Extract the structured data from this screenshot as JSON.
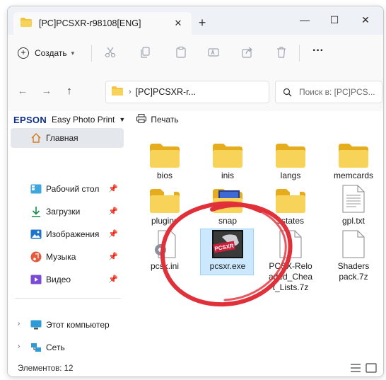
{
  "window": {
    "tab_title": "[PC]PCSXR-r98108[ENG]",
    "tab_close": "✕",
    "new_tab": "+",
    "minimize": "—",
    "maximize": "☐",
    "close": "✕"
  },
  "toolbar": {
    "create_label": "Создать",
    "more": "···"
  },
  "address": {
    "path": "[PC]PCSXR-r...",
    "search_placeholder": "Поиск в: [PC]PCS..."
  },
  "epson": {
    "logo": "EPSON",
    "app": "Easy Photo Print",
    "print": "Печать"
  },
  "sidebar": {
    "items": [
      {
        "label": "Главная"
      },
      {
        "label": "Рабочий стол"
      },
      {
        "label": "Загрузки"
      },
      {
        "label": "Изображения"
      },
      {
        "label": "Музыка"
      },
      {
        "label": "Видео"
      },
      {
        "label": "Этот компьютер"
      },
      {
        "label": "Сеть"
      }
    ]
  },
  "files": [
    {
      "name": "bios",
      "type": "folder"
    },
    {
      "name": "inis",
      "type": "folder"
    },
    {
      "name": "langs",
      "type": "folder"
    },
    {
      "name": "memcards",
      "type": "folder"
    },
    {
      "name": "plugins",
      "type": "folder"
    },
    {
      "name": "snap",
      "type": "folder-image"
    },
    {
      "name": "sstates",
      "type": "folder"
    },
    {
      "name": "gpl.txt",
      "type": "text"
    },
    {
      "name": "pcsx.ini",
      "type": "ini"
    },
    {
      "name": "pcsxr.exe",
      "type": "exe"
    },
    {
      "name": "PCSX-Reloaded_Cheat_Lists.7z",
      "type": "archive"
    },
    {
      "name": "Shaders pack.7z",
      "type": "archive"
    }
  ],
  "labels": {
    "f0": "bios",
    "f1": "inis",
    "f2": "langs",
    "f3": "memcards",
    "f4": "plugins",
    "f5": "snap",
    "f6": "sstates",
    "f7": "gpl.txt",
    "f8": "pcsx.ini",
    "f9": "pcsxr.exe",
    "f10a": "PCSX-Relo",
    "f10b": "aded_Chea",
    "f10c": "t_Lists.7z",
    "f11a": "Shaders",
    "f11b": "pack.7z",
    "exe_logo": "PCSXR"
  },
  "status": {
    "count": "Элементов: 12"
  },
  "colors": {
    "folder": "#f3c343",
    "folder_dark": "#e5ad1e",
    "accent": "#0067c0",
    "annotation": "#e0303a",
    "selection": "#cce8ff"
  }
}
